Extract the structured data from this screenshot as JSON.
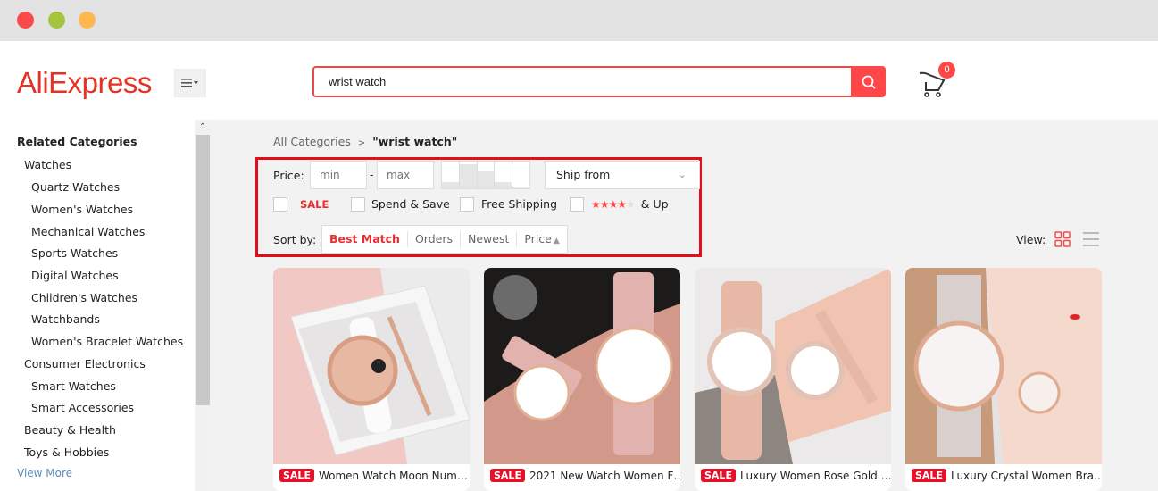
{
  "window": {
    "controls": [
      {
        "name": "close",
        "color": "#fc4a4a"
      },
      {
        "name": "minimize",
        "color": "#a3c43b"
      },
      {
        "name": "maximize",
        "color": "#ffb84d"
      }
    ]
  },
  "header": {
    "logo": "AliExpress",
    "menu_icon": "hamburger-dropdown-icon",
    "search": {
      "value": "wrist watch",
      "placeholder": ""
    },
    "search_icon": "search-icon",
    "cart": {
      "icon": "cart-icon",
      "count": "0"
    }
  },
  "sidebar": {
    "title": "Related Categories",
    "categories": [
      {
        "label": "Watches",
        "level": 1
      },
      {
        "label": "Quartz Watches",
        "level": 2
      },
      {
        "label": "Women's Watches",
        "level": 2
      },
      {
        "label": "Mechanical Watches",
        "level": 2
      },
      {
        "label": "Sports Watches",
        "level": 2
      },
      {
        "label": "Digital Watches",
        "level": 2
      },
      {
        "label": "Children's Watches",
        "level": 2
      },
      {
        "label": "Watchbands",
        "level": 2
      },
      {
        "label": "Women's Bracelet Watches",
        "level": 2
      },
      {
        "label": "Consumer Electronics",
        "level": 1
      },
      {
        "label": "Smart Watches",
        "level": 2
      },
      {
        "label": "Smart Accessories",
        "level": 2
      },
      {
        "label": "Beauty & Health",
        "level": 1
      },
      {
        "label": "Toys & Hobbies",
        "level": 1
      }
    ],
    "view_more": "View More"
  },
  "breadcrumb": {
    "root": "All Categories",
    "separator": ">",
    "current": "\"wrist watch\""
  },
  "filters": {
    "price_label": "Price:",
    "min_placeholder": "min",
    "max_placeholder": "max",
    "dash": "-",
    "price_histogram": [
      0.25,
      0.9,
      0.65,
      0.25,
      0.08
    ],
    "ship_from": "Ship from",
    "checkboxes": [
      {
        "label": "SALE",
        "checked": false
      },
      {
        "label": "Spend & Save",
        "checked": false
      },
      {
        "label": "Free Shipping",
        "checked": false
      },
      {
        "label": "& Up",
        "checked": false,
        "stars": 4
      }
    ],
    "highlight_color": "#e0101b"
  },
  "sort": {
    "label": "Sort by:",
    "options": [
      "Best Match",
      "Orders",
      "Newest",
      "Price"
    ],
    "active": "Best Match"
  },
  "view": {
    "label": "View:",
    "active": "grid"
  },
  "products": [
    {
      "badge": "SALE",
      "title": "Women Watch Moon Num…"
    },
    {
      "badge": "SALE",
      "title": "2021 New Watch Women F…"
    },
    {
      "badge": "SALE",
      "title": "Luxury Women Rose Gold …"
    },
    {
      "badge": "SALE",
      "title": "Luxury Crystal Women Bra…"
    }
  ]
}
